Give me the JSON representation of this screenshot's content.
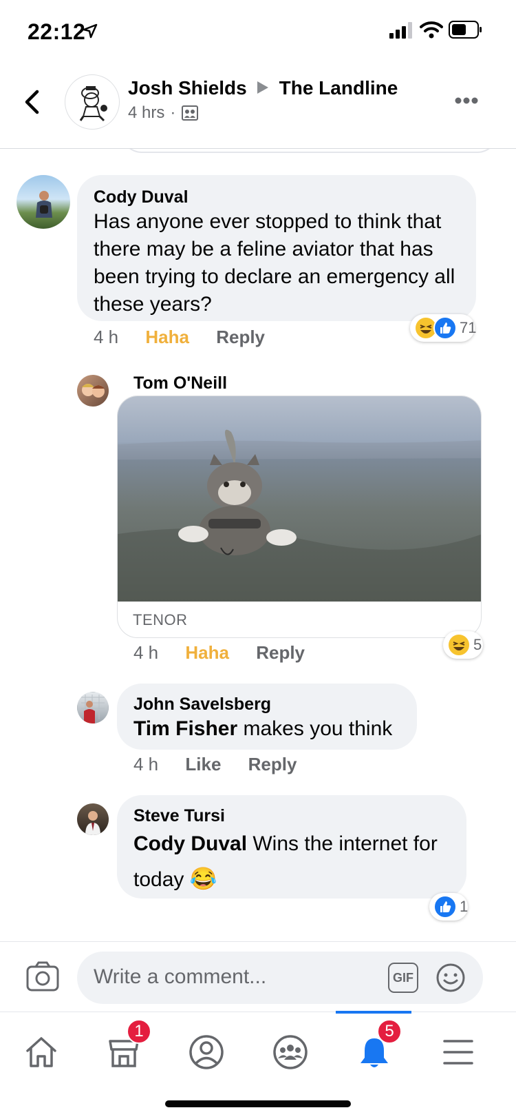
{
  "status_bar": {
    "time": "22:12"
  },
  "post_header": {
    "author": "Josh Shields",
    "group": "The Landline",
    "time": "4 hrs",
    "dot": "·"
  },
  "comments": [
    {
      "author": "Cody Duval",
      "text": "Has anyone ever stopped to think that there may be a feline aviator that has been trying to declare an emergency all these years?",
      "time": "4 h",
      "reaction_label": "Haha",
      "reply_label": "Reply",
      "reaction_count": "71"
    },
    {
      "author": "Tom O'Neill",
      "gif_source": "TENOR",
      "time": "4 h",
      "reaction_label": "Haha",
      "reply_label": "Reply",
      "reaction_count": "5"
    },
    {
      "author": "John Savelsberg",
      "mention": "Tim Fisher",
      "text": " makes you think",
      "time": "4 h",
      "reaction_label": "Like",
      "reply_label": "Reply"
    },
    {
      "author": "Steve Tursi",
      "mention": "Cody Duval",
      "text": " Wins the internet for today",
      "emoji": "😂",
      "reaction_count": "1"
    }
  ],
  "composer": {
    "placeholder": "Write a comment...",
    "gif_label": "GIF"
  },
  "tabbar": {
    "marketplace_badge": "1",
    "notifications_badge": "5",
    "active_color": "#1877f2"
  }
}
